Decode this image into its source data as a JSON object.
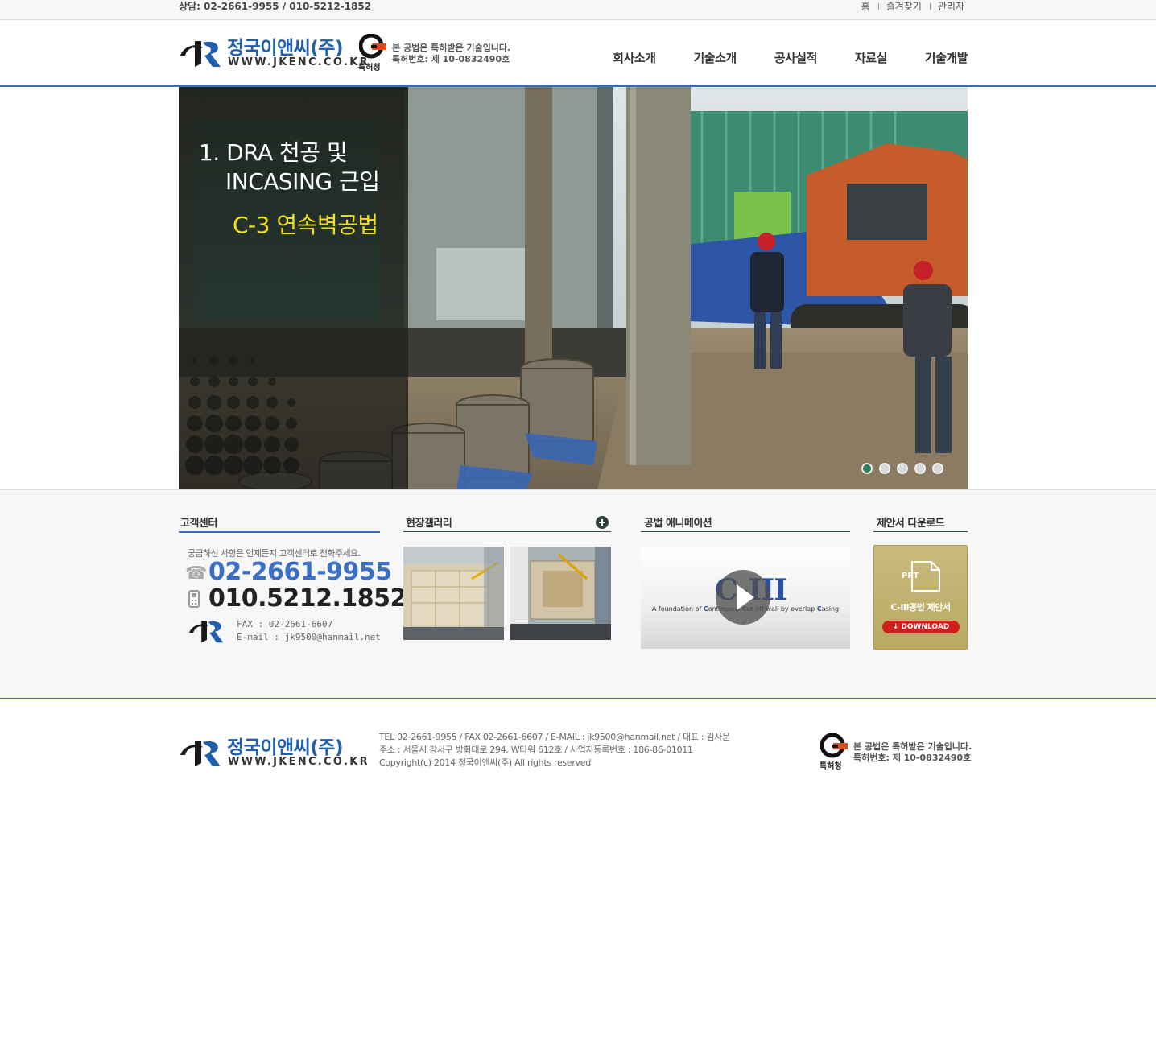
{
  "topbar": {
    "consult": "상담: 02-2661-9955 / 010-5212-1852",
    "links": [
      "홈",
      "즐겨찾기",
      "관리자"
    ]
  },
  "header": {
    "company_name": "정국이앤씨(주)",
    "company_url": "WWW.JKENC.CO.KR",
    "patent_mark_label": "특허청",
    "patent_line1": "본 공법은 특허받은 기술입니다.",
    "patent_line2": "특허번호: 제 10-0832490호",
    "nav": [
      "회사소개",
      "기술소개",
      "공사실적",
      "자료실",
      "기술개발"
    ]
  },
  "hero": {
    "title_line1": "1. DRA 천공 및",
    "title_line2": "INCASING 근입",
    "subtitle": "C-3 연속벽공법",
    "slides_total": 5,
    "active_slide": 1
  },
  "customer_center": {
    "title": "고객센터",
    "desc": "궁금하신 사항은 언제든지 고객센터로 전화주세요.",
    "phone": "02-2661-9955",
    "mobile": "010.5212.1852",
    "fax": "FAX : 02-2661-6607",
    "email": "E-mail : jk9500@hanmail.net"
  },
  "gallery": {
    "title": "현장갤러리"
  },
  "animation": {
    "title": "공법 애니메이션",
    "logo": "C-III",
    "caption_parts": [
      "A foundation of ",
      "C",
      "ontinuous ",
      "C",
      "ut off wall by overlap ",
      "C",
      "asing"
    ]
  },
  "download": {
    "title": "제안서 다운로드",
    "icon_label": "PPT",
    "name": "C-III공법 제안서",
    "button": "DOWNLOAD"
  },
  "footer": {
    "company_name": "정국이앤씨(주)",
    "company_url": "WWW.JKENC.CO.KR",
    "info_line1": "TEL 02-2661-9955 / FAX 02-2661-6607 / E-MAIL : jk9500@hanmail.net / 대표 : 김사문",
    "info_line2": "주소 : 서울시 강서구 방화대로 294, W타워 612호 / 사업자등록번호 : 186-86-01011",
    "info_line3": "Copyright(c) 2014 정국이앤씨(주) All rights reserved",
    "patent_mark_label": "특허청",
    "patent_line1": "본 공법은 특허받은 기술입니다.",
    "patent_line2": "특허번호: 제 10-0832490호"
  },
  "colors": {
    "brand_blue": "#1f5fae",
    "header_line": "#3a6bb5",
    "hero_subtitle": "#f3e21a",
    "download_red": "#d41d1d",
    "download_gold": "#c1b26f"
  }
}
